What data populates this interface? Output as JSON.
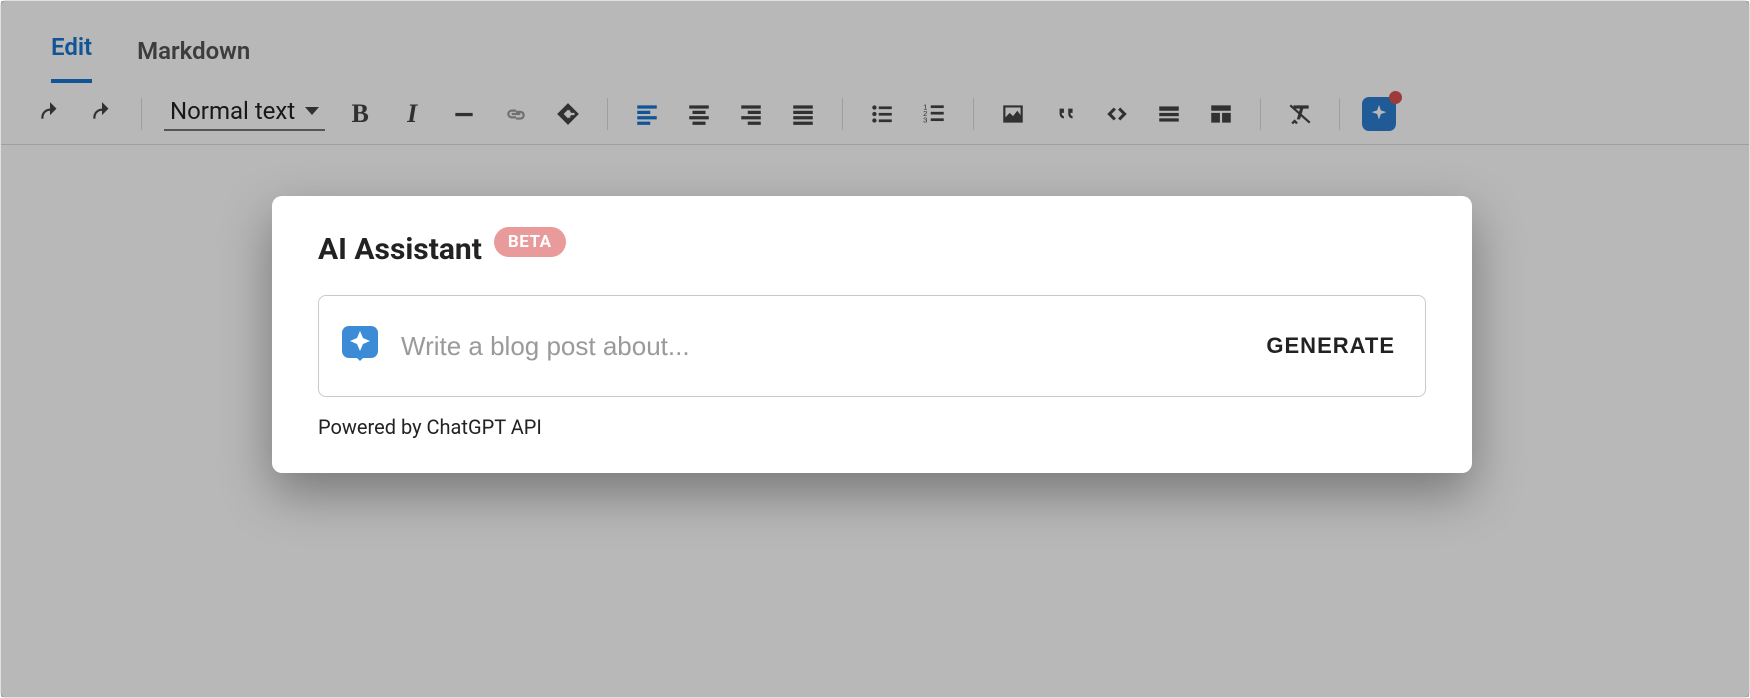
{
  "tabs": {
    "edit": "Edit",
    "markdown": "Markdown"
  },
  "toolbar": {
    "format_select": "Normal text"
  },
  "modal": {
    "title": "AI Assistant",
    "badge": "BETA",
    "placeholder": "Write a blog post about...",
    "generate": "GENERATE",
    "powered": "Powered by ChatGPT API"
  }
}
